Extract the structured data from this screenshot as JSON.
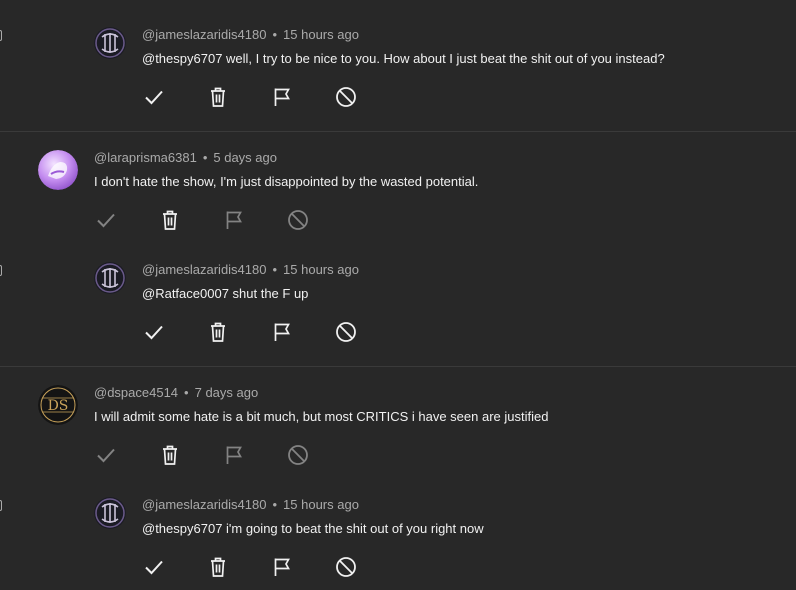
{
  "comments": [
    {
      "handle": "@jameslazaridis4180",
      "time": "15 hours ago",
      "text": "@thespy6707 well, I try to be nice to you. How about I just beat the shit out of you instead?",
      "avatar": "dark-rune-avatar",
      "reply": true
    },
    {
      "handle": "@laraprisma6381",
      "time": "5 days ago",
      "text": "I don't hate the show, I'm just disappointed by the wasted potential.",
      "avatar": "purple-avatar",
      "reply": false
    },
    {
      "handle": "@jameslazaridis4180",
      "time": "15 hours ago",
      "text": "@Ratface0007 shut the F up",
      "avatar": "dark-rune-avatar",
      "reply": true
    },
    {
      "handle": "@dspace4514",
      "time": "7 days ago",
      "text": "I will admit some hate is a bit much, but most CRITICS i have seen are justified",
      "avatar": "ds-logo-avatar",
      "avatar_text": "DS",
      "reply": false
    },
    {
      "handle": "@jameslazaridis4180",
      "time": "15 hours ago",
      "text": "@thespy6707 i'm going to beat the shit out of you right now",
      "avatar": "dark-rune-avatar",
      "reply": true
    }
  ],
  "meta_separator": "•",
  "actions": [
    "approve-icon",
    "delete-icon",
    "flag-icon",
    "block-icon"
  ],
  "colors": {
    "background": "#282828",
    "text": "#f1f1f1",
    "muted": "#aaaaaa",
    "divider": "#3a3a3a",
    "ds_gold": "#c8a25a"
  }
}
